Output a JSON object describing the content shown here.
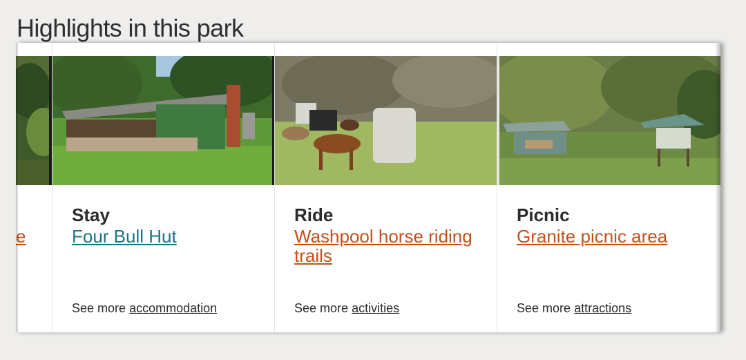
{
  "section": {
    "heading": "Highlights in this park"
  },
  "partial_card": {
    "link_fragment": "e"
  },
  "cards": [
    {
      "category": "Stay",
      "title": "Four Bull Hut",
      "see_more_prefix": "See more",
      "see_more_link": "accommodation",
      "link_color": "#1d7389"
    },
    {
      "category": "Ride",
      "title": "Washpool horse riding trails",
      "see_more_prefix": "See more",
      "see_more_link": "activities",
      "link_color": "#c2511c"
    },
    {
      "category": "Picnic",
      "title": "Granite picnic area",
      "see_more_prefix": "See more",
      "see_more_link": "attractions",
      "link_color": "#c2511c"
    }
  ],
  "colors": {
    "background": "#efeeec",
    "text": "#2b2b2b",
    "link_blue": "#1d7389",
    "link_orange": "#c2511c"
  }
}
